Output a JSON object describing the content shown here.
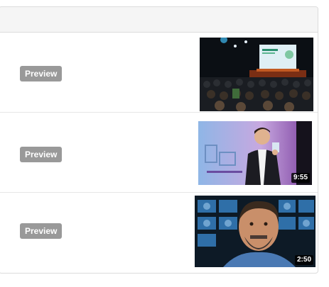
{
  "videos": [
    {
      "preview_label": "Preview",
      "thumbnail": "conference-audience-thumbnail",
      "duration": ""
    },
    {
      "preview_label": "Preview",
      "thumbnail": "speaker-on-stage-thumbnail",
      "duration": "9:55"
    },
    {
      "preview_label": "Preview",
      "thumbnail": "interview-man-thumbnail",
      "duration": "2:50"
    }
  ],
  "colors": {
    "preview_button_bg": "#999999",
    "preview_button_text": "#ffffff",
    "header_bg": "#f5f5f5",
    "border": "#dcdcdc"
  }
}
